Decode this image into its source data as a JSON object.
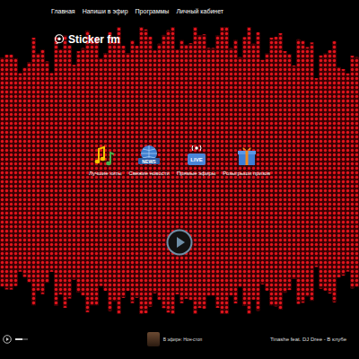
{
  "nav": {
    "items": [
      {
        "label": "Главная"
      },
      {
        "label": "Напиши в эфир"
      },
      {
        "label": "Программы"
      },
      {
        "label": "Личный кабинет"
      }
    ]
  },
  "logo": {
    "text": "Sticker fm"
  },
  "features": [
    {
      "label": "Лучшие хиты",
      "kind": "music"
    },
    {
      "label": "Свежие новости",
      "kind": "news",
      "badge": "NEWS"
    },
    {
      "label": "Прямые эфиры",
      "kind": "live",
      "badge": "LIVE"
    },
    {
      "label": "Розыгрыши призов",
      "kind": "gift"
    }
  ],
  "player": {
    "volume": {
      "level": 0.6
    },
    "on_air": "В эфире: Нон-стоп",
    "track": "Tinashe feat. DJ Dree - В клубе"
  }
}
